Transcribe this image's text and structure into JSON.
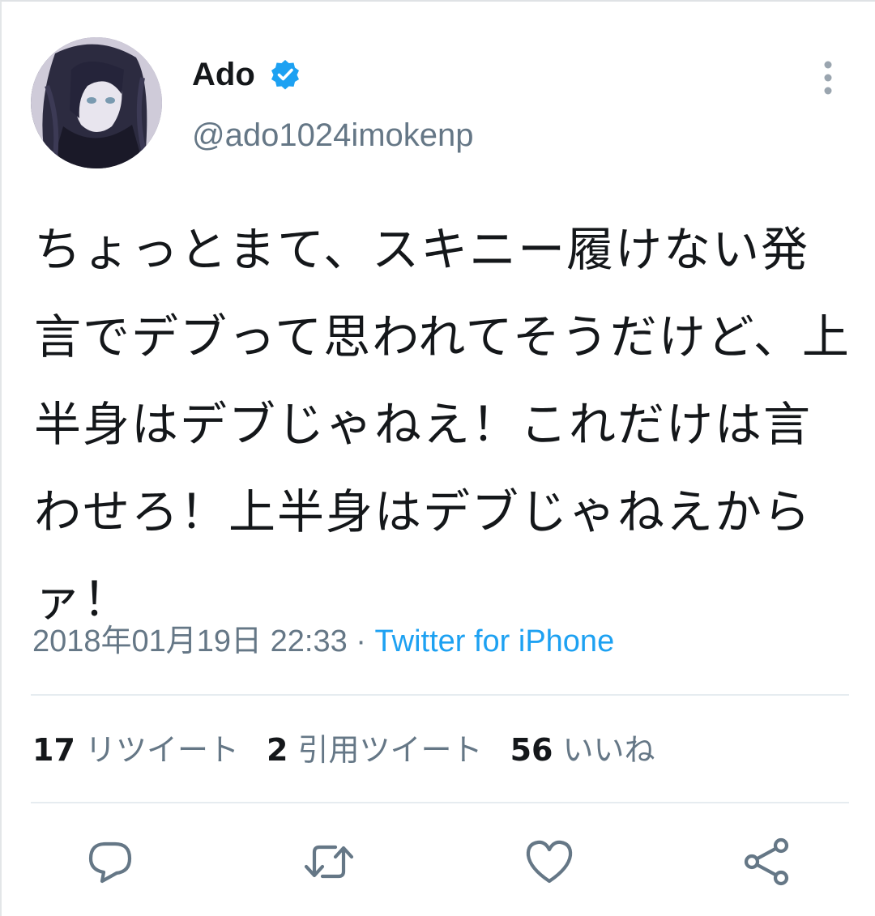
{
  "user": {
    "name": "Ado",
    "handle": "@ado1024imokenp"
  },
  "tweet": {
    "text": "ちょっとまて、スキニー履けない発言でデブって思われてそうだけど、上半身はデブじゃねえ！これだけは言わせろ！上半身はデブじゃねえからァ！",
    "timestamp": "2018年01月19日 22:33",
    "separator": " · ",
    "source": "Twitter for iPhone"
  },
  "stats": {
    "retweets_count": "17",
    "retweets_label": "リツイート",
    "quotes_count": "2",
    "quotes_label": "引用ツイート",
    "likes_count": "56",
    "likes_label": "いいね"
  },
  "colors": {
    "text": "#14171a",
    "secondary": "#657786",
    "accent": "#1da1f2",
    "divider": "#e6ecf0"
  },
  "icons": {
    "verified": "verified-badge-icon",
    "more": "more-vertical-icon",
    "reply": "reply-icon",
    "retweet": "retweet-icon",
    "like": "heart-icon",
    "share": "share-icon"
  }
}
